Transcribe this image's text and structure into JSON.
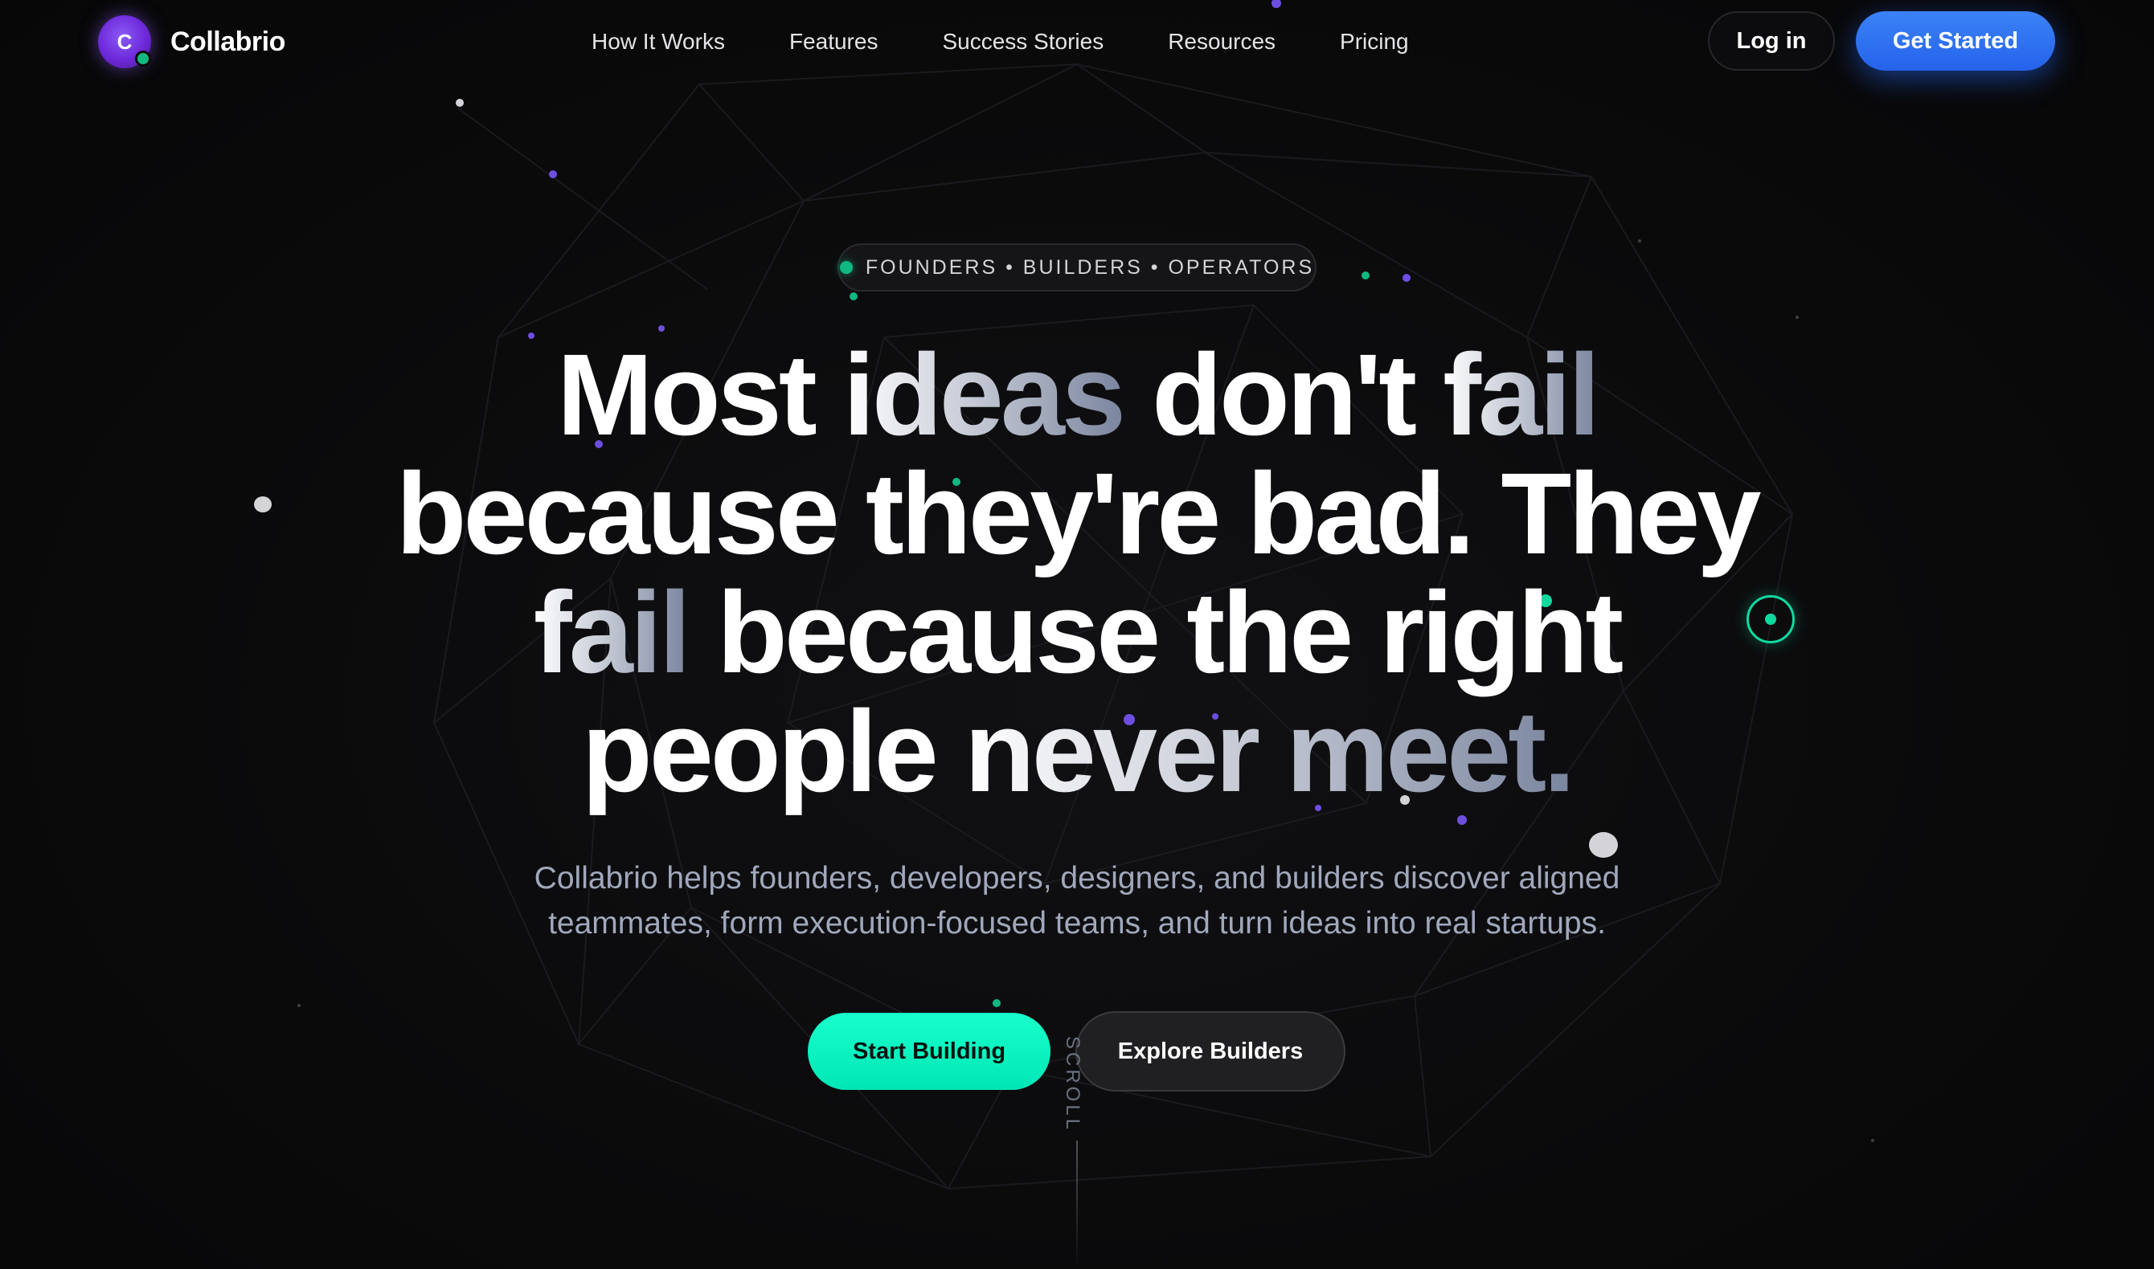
{
  "brand": {
    "logo_letter": "C",
    "name": "Collabrio"
  },
  "nav": {
    "links": [
      "How It Works",
      "Features",
      "Success Stories",
      "Resources",
      "Pricing"
    ],
    "login_label": "Log in",
    "cta_label": "Get Started"
  },
  "hero": {
    "eyebrow": "FOUNDERS • BUILDERS • OPERATORS",
    "headline": {
      "line1": [
        "Most ",
        "ideas",
        " don't ",
        "fail"
      ],
      "line2": [
        "because they're bad. They"
      ],
      "line3": [
        "fail",
        " because the right"
      ],
      "line4": [
        "people ",
        "never meet."
      ]
    },
    "subcopy": {
      "line1": "Collabrio helps founders, developers, designers, and builders discover aligned",
      "line2": "teammates, form execution-focused teams, and turn ideas into real startups."
    },
    "primary_cta": "Start Building",
    "secondary_cta": "Explore Builders",
    "scroll_label": "SCROLL"
  },
  "colors": {
    "background": "#0a0a0b",
    "accent_blue": "#2563eb",
    "accent_mint": "#0ff5c1",
    "accent_green": "#10b981",
    "accent_purple": "#8b5cf6",
    "muted_text": "#a1a8bc"
  },
  "icons": {
    "logo": "brand-logo-icon",
    "status_dot": "status-dot-icon",
    "target": "target-ring-icon"
  }
}
